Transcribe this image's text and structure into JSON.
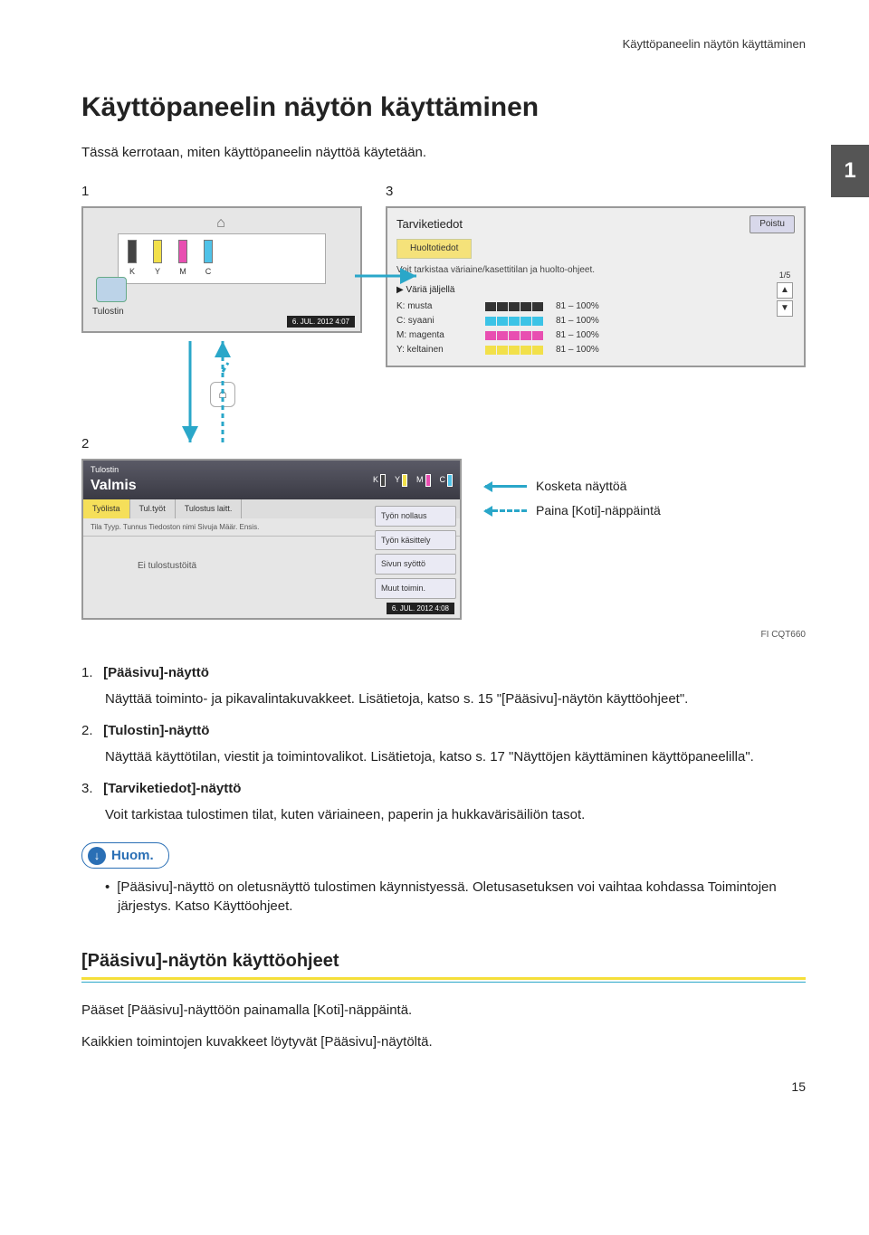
{
  "running_head": "Käyttöpaneelin näytön käyttäminen",
  "title": "Käyttöpaneelin näytön käyttäminen",
  "intro": "Tässä kerrotaan, miten käyttöpaneelin näyttöä käytetään.",
  "chapter_number": "1",
  "callout_numbers": {
    "one": "1",
    "two": "2",
    "three": "3"
  },
  "screen_home": {
    "printer_label": "Tulostin",
    "toners": [
      {
        "label": "K"
      },
      {
        "label": "Y"
      },
      {
        "label": "M"
      },
      {
        "label": "C"
      }
    ],
    "footer_date": "6. JUL.  2012  4:07"
  },
  "screen_info": {
    "title": "Tarviketiedot",
    "exit": "Poistu",
    "service_btn": "Huoltotiedot",
    "desc": "Voit tarkistaa väriaine/kasettitilan ja huolto-ohjeet.",
    "section_head": "▶ Väriä jäljellä",
    "rows": [
      {
        "name": "K: musta",
        "cls": "ib-k",
        "pct": "81 – 100%"
      },
      {
        "name": "C: syaani",
        "cls": "ib-c",
        "pct": "81 – 100%"
      },
      {
        "name": "M: magenta",
        "cls": "ib-m",
        "pct": "81 – 100%"
      },
      {
        "name": "Y: keltainen",
        "cls": "ib-y",
        "pct": "81 – 100%"
      }
    ],
    "page_indicator": "1/5"
  },
  "screen_printer": {
    "tab_label": "Tulostin",
    "status": "Valmis",
    "mini_toners": [
      "K",
      "Y",
      "M",
      "C"
    ],
    "tabs": [
      "Työlista",
      "Tul.työt",
      "Tulostus laitt."
    ],
    "side_buttons": [
      "Työn nollaus",
      "Työn käsittely",
      "Sivun syöttö",
      "Muut toimin."
    ],
    "columns": "Tila   Tyyp.   Tunnus   Tiedoston nimi Sivuja Määr. Ensis.",
    "no_jobs": "Ei tulostustöitä",
    "footer_date": "6. JUL.  2012  4:08"
  },
  "legend": {
    "touch": "Kosketa näyttöä",
    "press_home": "Paina [Koti]-näppäintä"
  },
  "figure_code": "FI CQT660",
  "items": [
    {
      "num": "1.",
      "head": "[Pääsivu]-näyttö",
      "body": "Näyttää toiminto- ja pikavalintakuvakkeet. Lisätietoja, katso s. 15 \"[Pääsivu]-näytön käyttöohjeet\"."
    },
    {
      "num": "2.",
      "head": "[Tulostin]-näyttö",
      "body": "Näyttää käyttötilan, viestit ja toimintovalikot. Lisätietoja, katso s. 17 \"Näyttöjen käyttäminen käyttöpaneelilla\"."
    },
    {
      "num": "3.",
      "head": "[Tarviketiedot]-näyttö",
      "body": "Voit tarkistaa tulostimen tilat, kuten väriaineen, paperin ja hukkavärisäiliön tasot."
    }
  ],
  "note_label": "Huom.",
  "note_bullet": "[Pääsivu]-näyttö on oletusnäyttö tulostimen käynnistyessä. Oletusasetuksen voi vaihtaa kohdassa Toimintojen järjestys. Katso Käyttöohjeet.",
  "subsection": "[Pääsivu]-näytön käyttöohjeet",
  "sub_para1": "Pääset [Pääsivu]-näyttöön painamalla [Koti]-näppäintä.",
  "sub_para2": "Kaikkien toimintojen kuvakkeet löytyvät [Pääsivu]-näytöltä.",
  "page_number": "15"
}
